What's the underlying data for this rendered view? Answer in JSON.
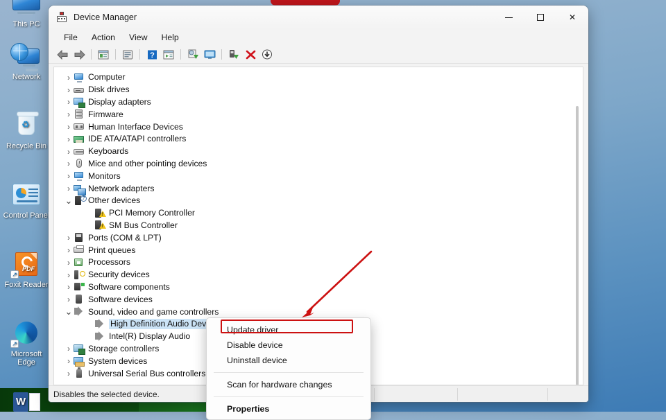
{
  "desktop": {
    "icons": [
      {
        "label": "This PC",
        "icon": "computer-icon"
      },
      {
        "label": "Network",
        "icon": "network-globe-icon"
      },
      {
        "label": "Recycle Bin",
        "icon": "recycle-bin-icon"
      },
      {
        "label": "Control Panel",
        "icon": "control-panel-icon"
      },
      {
        "label": "Foxit Reader",
        "icon": "pdf-reader-icon"
      },
      {
        "label": "Microsoft Edge",
        "icon": "edge-browser-icon"
      },
      {
        "label": "",
        "icon": "word-icon"
      }
    ]
  },
  "window": {
    "title": "Device Manager",
    "icon": "device-manager-icon",
    "controls": {
      "minimize": "—",
      "maximize": "□",
      "close": "✕"
    },
    "menus": [
      "File",
      "Action",
      "View",
      "Help"
    ],
    "toolbar": [
      {
        "name": "back-icon",
        "glyph": "⬅"
      },
      {
        "name": "forward-icon",
        "glyph": "➡"
      },
      {
        "name": "separator",
        "glyph": ""
      },
      {
        "name": "properties-icon",
        "glyph": ""
      },
      {
        "name": "separator",
        "glyph": ""
      },
      {
        "name": "help-icon",
        "glyph": "?"
      },
      {
        "name": "separator",
        "glyph": ""
      },
      {
        "name": "scan-hardware-icon",
        "glyph": ""
      },
      {
        "name": "update-driver-icon",
        "glyph": ""
      },
      {
        "name": "separator",
        "glyph": ""
      },
      {
        "name": "show-hidden-devices-icon",
        "glyph": ""
      },
      {
        "name": "separator",
        "glyph": ""
      },
      {
        "name": "enable-device-icon",
        "glyph": ""
      },
      {
        "name": "uninstall-device-icon",
        "glyph": "✖"
      },
      {
        "name": "update-arrow-icon",
        "glyph": "⬇"
      }
    ],
    "status": {
      "hint": "Disables the selected device.",
      "pane2": "",
      "pane3": ""
    }
  },
  "tree": [
    {
      "label": "Computer",
      "level": 0,
      "expander": "collapsed",
      "icon": "computer-icon"
    },
    {
      "label": "Disk drives",
      "level": 0,
      "expander": "collapsed",
      "icon": "disk-drive-icon"
    },
    {
      "label": "Display adapters",
      "level": 0,
      "expander": "collapsed",
      "icon": "display-adapter-icon"
    },
    {
      "label": "Firmware",
      "level": 0,
      "expander": "collapsed",
      "icon": "firmware-icon"
    },
    {
      "label": "Human Interface Devices",
      "level": 0,
      "expander": "collapsed",
      "icon": "hid-icon"
    },
    {
      "label": "IDE ATA/ATAPI controllers",
      "level": 0,
      "expander": "collapsed",
      "icon": "ide-controller-icon"
    },
    {
      "label": "Keyboards",
      "level": 0,
      "expander": "collapsed",
      "icon": "keyboard-icon"
    },
    {
      "label": "Mice and other pointing devices",
      "level": 0,
      "expander": "collapsed",
      "icon": "mouse-icon"
    },
    {
      "label": "Monitors",
      "level": 0,
      "expander": "collapsed",
      "icon": "monitor-icon"
    },
    {
      "label": "Network adapters",
      "level": 0,
      "expander": "collapsed",
      "icon": "network-adapter-icon"
    },
    {
      "label": "Other devices",
      "level": 0,
      "expander": "expanded",
      "icon": "other-devices-icon"
    },
    {
      "label": "PCI Memory Controller",
      "level": 1,
      "expander": "none",
      "icon": "unknown-device-warning-icon"
    },
    {
      "label": "SM Bus Controller",
      "level": 1,
      "expander": "none",
      "icon": "unknown-device-warning-icon"
    },
    {
      "label": "Ports (COM & LPT)",
      "level": 0,
      "expander": "collapsed",
      "icon": "port-icon"
    },
    {
      "label": "Print queues",
      "level": 0,
      "expander": "collapsed",
      "icon": "printer-icon"
    },
    {
      "label": "Processors",
      "level": 0,
      "expander": "collapsed",
      "icon": "processor-icon"
    },
    {
      "label": "Security devices",
      "level": 0,
      "expander": "collapsed",
      "icon": "security-device-icon"
    },
    {
      "label": "Software components",
      "level": 0,
      "expander": "collapsed",
      "icon": "software-component-icon"
    },
    {
      "label": "Software devices",
      "level": 0,
      "expander": "collapsed",
      "icon": "software-device-icon"
    },
    {
      "label": "Sound, video and game controllers",
      "level": 0,
      "expander": "expanded",
      "icon": "sound-controller-icon"
    },
    {
      "label": "High Definition Audio Device",
      "level": 1,
      "expander": "none",
      "icon": "sound-device-icon",
      "selected": true
    },
    {
      "label": "Intel(R) Display Audio",
      "level": 1,
      "expander": "none",
      "icon": "sound-device-icon"
    },
    {
      "label": "Storage controllers",
      "level": 0,
      "expander": "collapsed",
      "icon": "storage-controller-icon"
    },
    {
      "label": "System devices",
      "level": 0,
      "expander": "collapsed",
      "icon": "system-device-icon"
    },
    {
      "label": "Universal Serial Bus controllers",
      "level": 0,
      "expander": "collapsed",
      "icon": "usb-controller-icon"
    }
  ],
  "context_menu": {
    "items": [
      {
        "label": "Update driver",
        "bold": false,
        "highlighted": true
      },
      {
        "label": "Disable device",
        "bold": false,
        "highlighted": false
      },
      {
        "label": "Uninstall device",
        "bold": false,
        "highlighted": false
      },
      {
        "separator": true
      },
      {
        "label": "Scan for hardware changes",
        "bold": false,
        "highlighted": false
      },
      {
        "separator": true
      },
      {
        "label": "Properties",
        "bold": true,
        "highlighted": false
      }
    ]
  },
  "annotations": {
    "highlight_color": "#cc1111",
    "arrow_target": "Update driver"
  }
}
